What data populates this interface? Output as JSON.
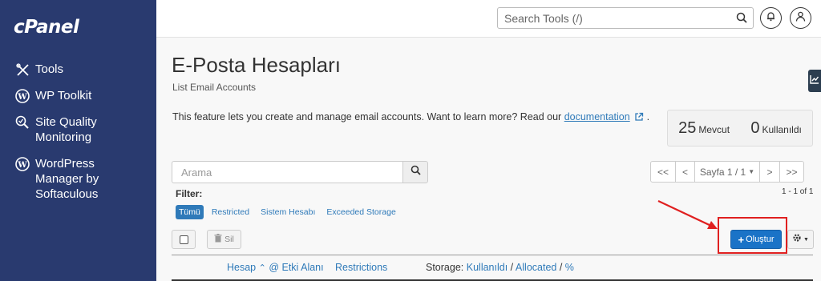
{
  "sidebar": {
    "logo": "cPanel",
    "items": [
      {
        "label": "Tools",
        "icon": "tools-icon"
      },
      {
        "label": "WP Toolkit",
        "icon": "wordpress-icon"
      },
      {
        "label": "Site Quality\nMonitoring",
        "icon": "site-quality-icon"
      },
      {
        "label": "WordPress\nManager by\nSoftaculous",
        "icon": "wordpress-icon"
      }
    ]
  },
  "header": {
    "search_placeholder": "Search Tools (/)",
    "icons": [
      "search-icon",
      "notifications-bell-icon",
      "user-account-icon"
    ]
  },
  "page": {
    "title": "E-Posta Hesapları",
    "subtitle": "List Email Accounts",
    "description_prefix": "This feature lets you create and manage email accounts. Want to learn more? Read our ",
    "description_link": "documentation",
    "description_suffix": "."
  },
  "stats": {
    "available_count": "25",
    "available_label": "Mevcut",
    "used_count": "0",
    "used_label": "Kullanıldı"
  },
  "search": {
    "placeholder": "Arama"
  },
  "pagination": {
    "first": "<<",
    "prev": "<",
    "page_label": "Sayfa 1 / 1",
    "next": ">",
    "last": ">>",
    "range": "1 - 1 of 1"
  },
  "filter": {
    "label": "Filter:",
    "options": [
      {
        "label": "Tümü",
        "active": true
      },
      {
        "label": "Restricted",
        "active": false
      },
      {
        "label": "Sistem Hesabı",
        "active": false
      },
      {
        "label": "Exceeded Storage",
        "active": false
      }
    ]
  },
  "toolbar": {
    "delete_label": "Sil",
    "create_label": "Oluştur"
  },
  "table": {
    "col_account": "Hesap",
    "col_domain": "@ Etki Alanı",
    "col_restrictions": "Restrictions",
    "col_storage_prefix": "Storage:",
    "col_storage_used": "Kullanıldı",
    "col_storage_allocated": "Allocated",
    "col_storage_percent": "%"
  },
  "colors": {
    "sidebar_bg": "#293a6f",
    "primary_button": "#1a73c7",
    "link": "#2f7ab9",
    "highlight_annotation": "#e02020"
  }
}
